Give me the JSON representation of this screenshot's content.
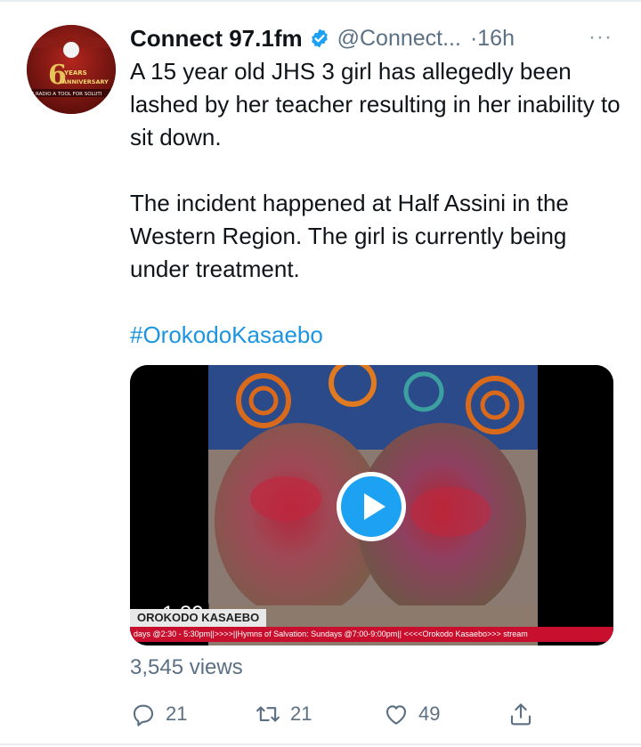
{
  "tweet": {
    "display_name": "Connect 97.1fm",
    "handle": "@Connect...",
    "time": "·16h",
    "more": "···",
    "text_p1": "A 15 year old JHS 3 girl has allegedly been lashed by her teacher resulting in her inability to sit down.",
    "text_p2": "The incident happened at Half Assini in the Western Region. The girl is currently being under treatment.",
    "hashtag": "#OrokodoKasaebo",
    "avatar_text": "6 YEARS ANNIVERSARY",
    "avatar_tagline": "G RADIO A TOOL FOR SOLUTI"
  },
  "media": {
    "duration": "1:39",
    "lower_third": "OROKODO KASAEBO",
    "ticker": "days @2:30 - 5:30pm||>>>>||Hymns of Salvation: Sundays @7:00-9:00pm|| <<<<Orokodo Kasaebo>>> stream"
  },
  "stats": {
    "views": "3,545 views",
    "replies": "21",
    "retweets": "21",
    "likes": "49"
  },
  "colors": {
    "accent": "#1da1f2",
    "link": "#1b95e0",
    "secondary_text": "#5b7083",
    "verified": "#1da1f2"
  },
  "icons": [
    "verified-badge-icon",
    "more-icon",
    "play-icon",
    "reply-icon",
    "retweet-icon",
    "like-icon",
    "share-icon"
  ]
}
